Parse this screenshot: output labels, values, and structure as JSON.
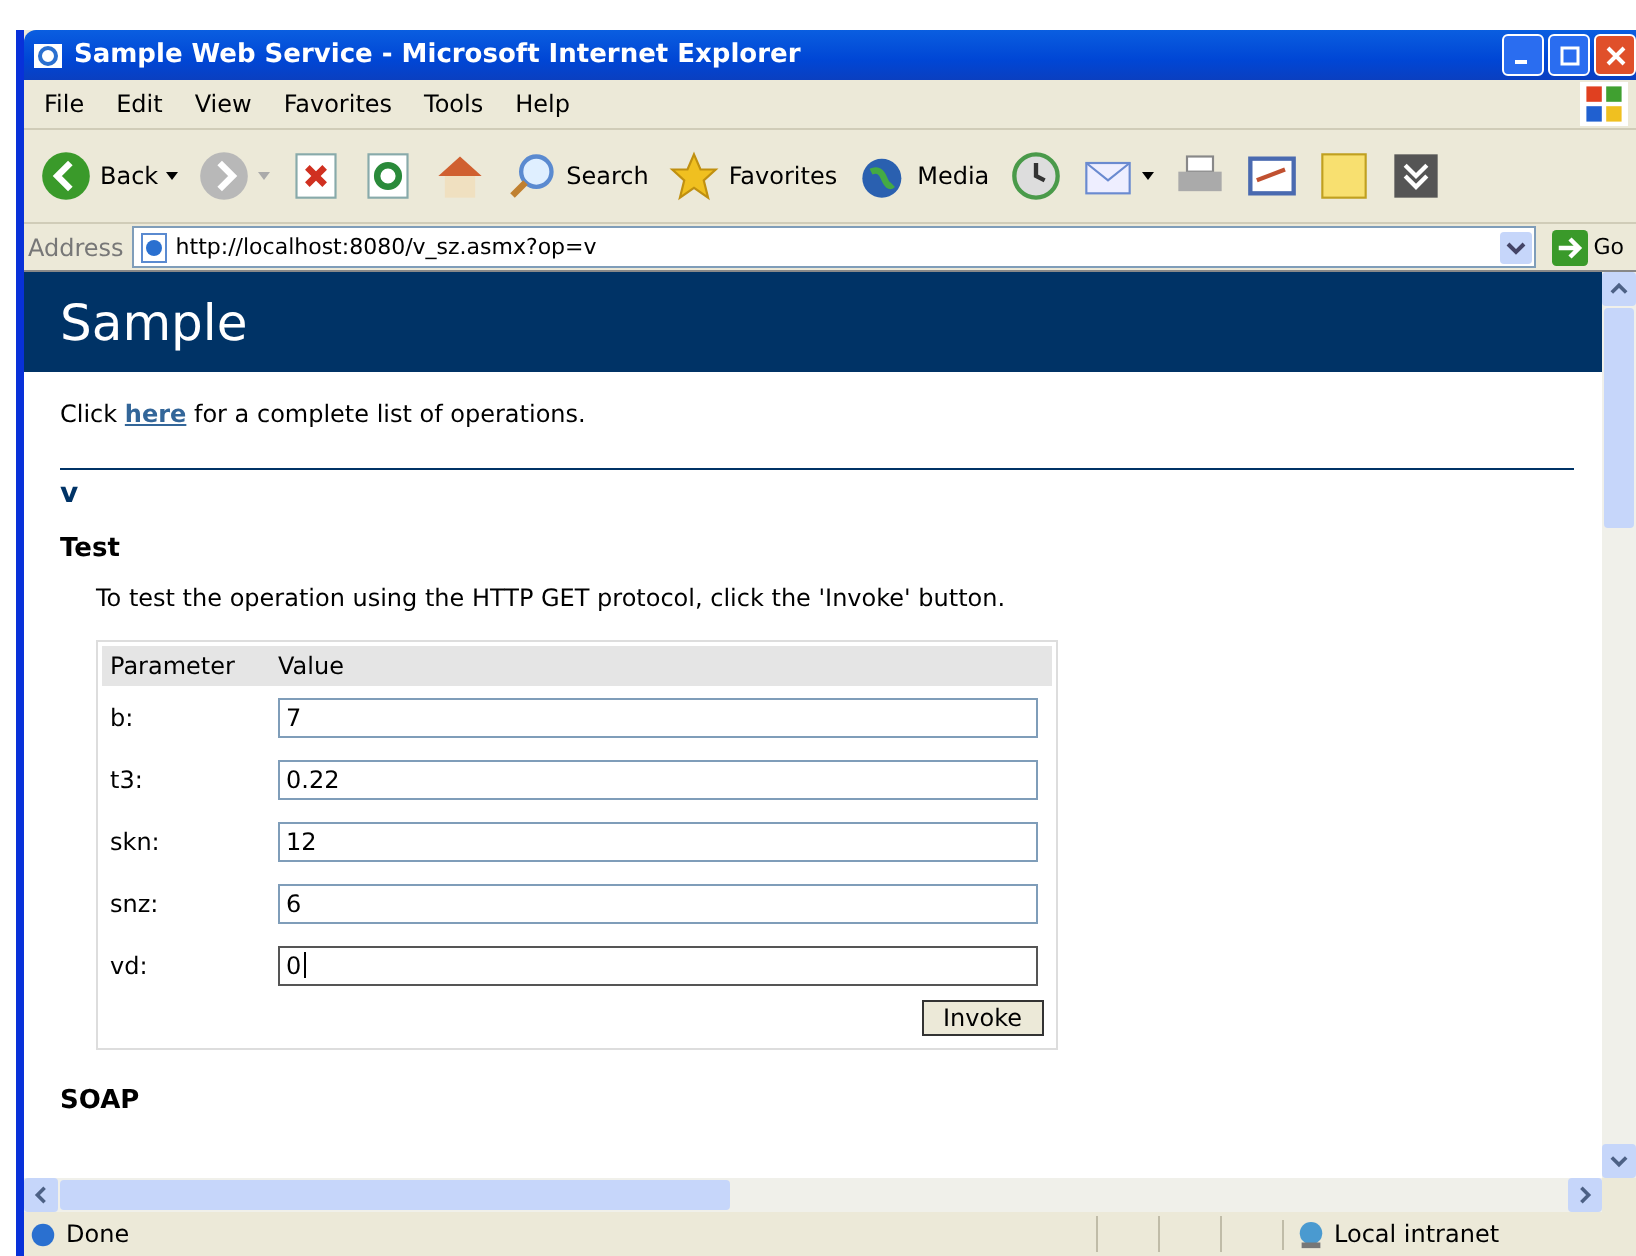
{
  "window": {
    "title": "Sample Web Service - Microsoft Internet Explorer"
  },
  "menu": [
    "File",
    "Edit",
    "View",
    "Favorites",
    "Tools",
    "Help"
  ],
  "toolbar": [
    {
      "kind": "back",
      "label": "Back",
      "dropdown": true
    },
    {
      "kind": "forward",
      "dropdown": true
    },
    {
      "kind": "stop"
    },
    {
      "kind": "refresh"
    },
    {
      "kind": "home"
    },
    {
      "kind": "search",
      "label": "Search"
    },
    {
      "kind": "favorites",
      "label": "Favorites"
    },
    {
      "kind": "media",
      "label": "Media"
    },
    {
      "kind": "history"
    },
    {
      "kind": "mail",
      "dropdown": true
    },
    {
      "kind": "print"
    },
    {
      "kind": "edit"
    },
    {
      "kind": "note"
    },
    {
      "kind": "tool"
    }
  ],
  "address": {
    "label": "Address",
    "url": "http://localhost:8080/v_sz.asmx?op=v",
    "go": "Go"
  },
  "page": {
    "heading": "Sample",
    "intro": {
      "before": "Click",
      "link": "here",
      "after": "for a complete list of operations."
    },
    "operation": "v",
    "section": "Test",
    "instructions": "To test the operation using the HTTP GET protocol, click the 'Invoke' button.",
    "columns": [
      "Parameter",
      "Value"
    ],
    "params": [
      {
        "name": "b:",
        "value": "7",
        "focused": false
      },
      {
        "name": "t3:",
        "value": "0.22",
        "focused": false
      },
      {
        "name": "skn:",
        "value": "12",
        "focused": false
      },
      {
        "name": "snz:",
        "value": "6",
        "focused": false
      },
      {
        "name": "vd:",
        "value": "0",
        "focused": true
      }
    ],
    "invoke": "Invoke",
    "next_section": "SOAP"
  },
  "status_bar": {
    "text": "Done",
    "zone": "Local intranet"
  }
}
